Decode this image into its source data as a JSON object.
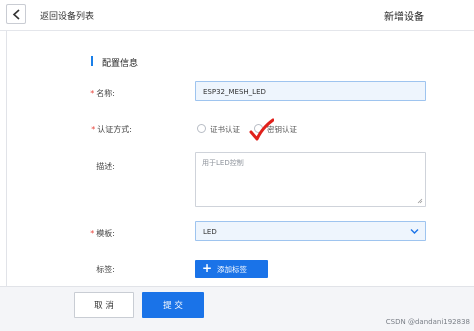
{
  "header": {
    "back_label": "返回设备列表",
    "title": "新增设备"
  },
  "section": {
    "title": "配置信息"
  },
  "form": {
    "name": {
      "label": "名称:",
      "required_mark": "*",
      "value": "ESP32_MESH_LED"
    },
    "auth": {
      "label": "认证方式:",
      "required_mark": "*",
      "options": [
        "证书认证",
        "密钥认证"
      ]
    },
    "description": {
      "label": "描述:",
      "placeholder": "用于LED控制"
    },
    "template": {
      "label": "模板:",
      "required_mark": "*",
      "value": "LED"
    },
    "tags": {
      "label": "标签:",
      "add_label": "添加标签",
      "add_icon": "+"
    }
  },
  "footer": {
    "cancel_label": "取 消",
    "submit_label": "提 交"
  },
  "watermark": "CSDN @dandani192838",
  "colors": {
    "accent": "#1a73e8",
    "required": "#e8453c",
    "annotation": "#e0201b"
  }
}
